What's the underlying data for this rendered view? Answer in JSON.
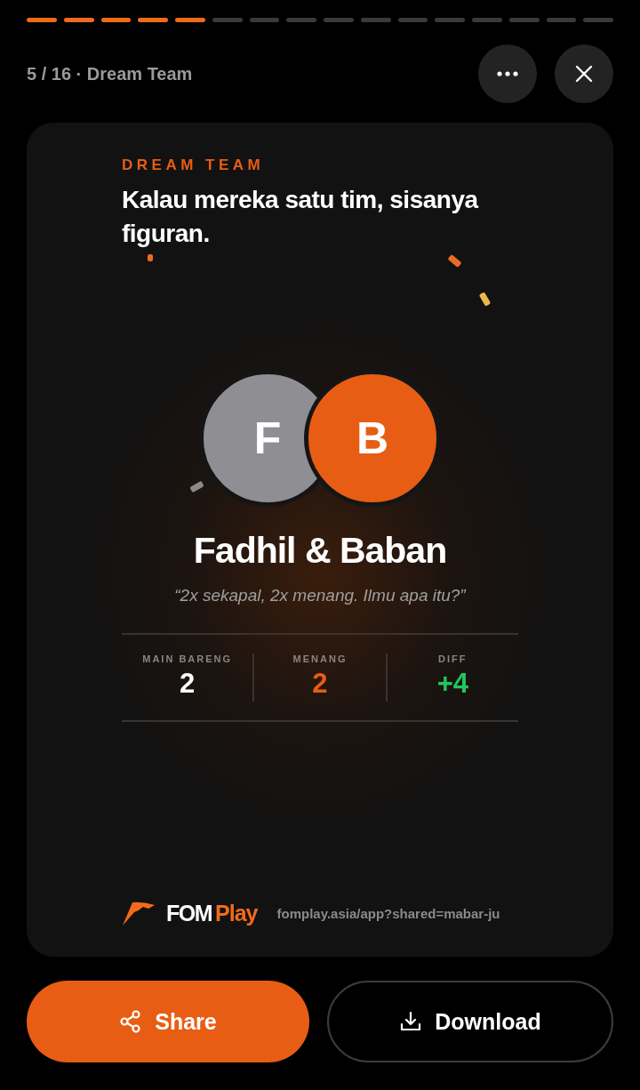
{
  "progress": [
    {
      "done": true
    },
    {
      "done": true
    },
    {
      "done": true
    },
    {
      "done": true
    },
    {
      "done": true
    },
    {
      "done": false
    },
    {
      "done": false
    },
    {
      "done": false
    },
    {
      "done": false
    },
    {
      "done": false
    },
    {
      "done": false
    },
    {
      "done": false
    },
    {
      "done": false
    },
    {
      "done": false
    },
    {
      "done": false
    },
    {
      "done": false
    }
  ],
  "header": {
    "title": "5 / 16 · Dream Team"
  },
  "card": {
    "eyebrow": "DREAM TEAM",
    "headline": "Kalau mereka satu tim, sisanya figuran.",
    "avatars": [
      {
        "letter": "F",
        "color": "#8e8e93"
      },
      {
        "letter": "B",
        "color": "#e85d14"
      }
    ],
    "names": "Fadhil & Baban",
    "quote": "“2x sekapal, 2x menang. Ilmu apa itu?”",
    "stats": [
      {
        "label": "MAIN BARENG",
        "value": "2",
        "color": "#ffffff"
      },
      {
        "label": "MENANG",
        "value": "2",
        "color": "#e85d14"
      },
      {
        "label": "DIFF",
        "value": "+4",
        "color": "#22c55e"
      }
    ],
    "logo": {
      "brand": "FOM",
      "product": "Play"
    },
    "link": "fomplay.asia/app?shared=mabar-ju"
  },
  "buttons": [
    {
      "kind": "share",
      "label": "Share"
    },
    {
      "kind": "download",
      "label": "Download"
    }
  ]
}
